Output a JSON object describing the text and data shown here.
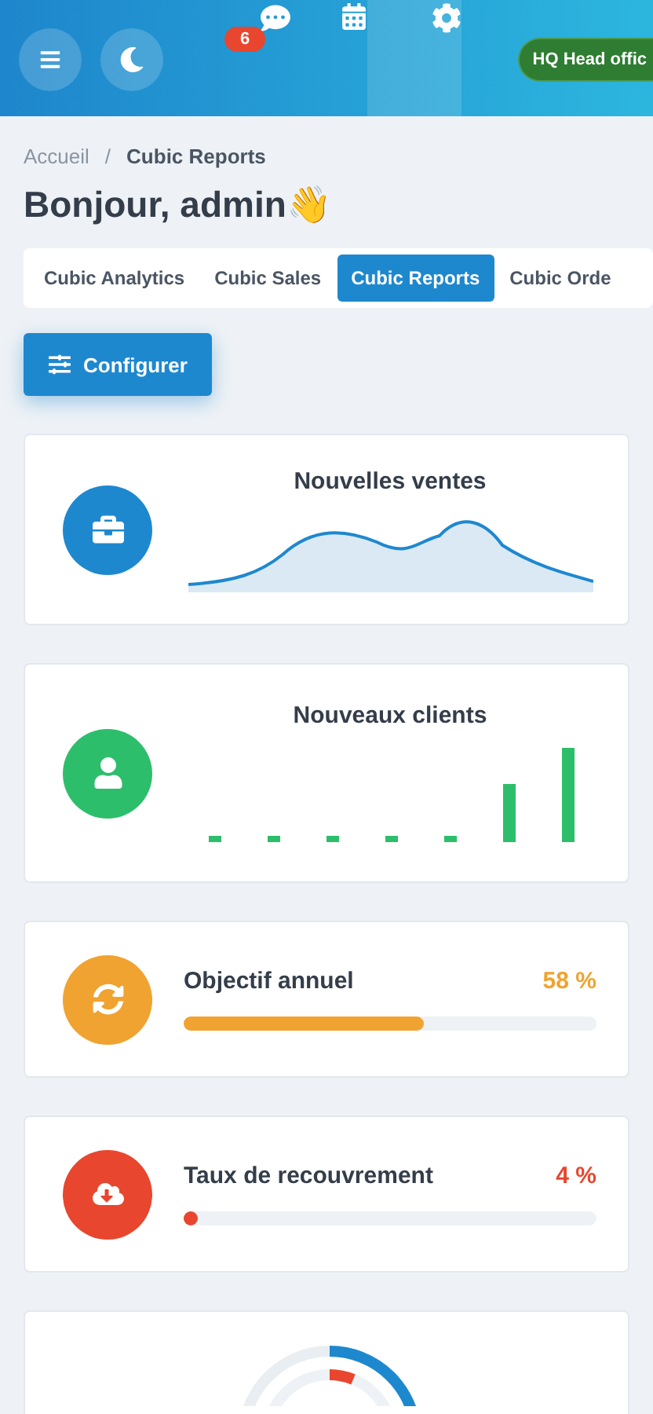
{
  "header": {
    "notifications_badge": "6",
    "branch": "HQ Head offic"
  },
  "breadcrumb": [
    "Accueil",
    "Cubic Reports"
  ],
  "breadcrumb_separator": "/",
  "greeting": "Bonjour, admin👋",
  "tabs": [
    {
      "label": "Cubic Analytics",
      "selected": false
    },
    {
      "label": "Cubic Sales",
      "selected": false
    },
    {
      "label": "Cubic Reports",
      "selected": true
    },
    {
      "label": "Cubic Orde",
      "selected": false
    }
  ],
  "configure_button": "Configurer",
  "cards": [
    {
      "kind": "area",
      "title": "Nouvelles ventes",
      "color": "#1e88cf"
    },
    {
      "kind": "bars",
      "title": "Nouveaux clients",
      "color": "#2dbe6c"
    },
    {
      "kind": "progress",
      "title": "Objectif annuel",
      "value": "58 %",
      "level": 0.58,
      "color": "#f0a330"
    },
    {
      "kind": "progress",
      "title": "Taux de recouvrement",
      "value": "4 %",
      "level": 0.03,
      "color": "#e8462e"
    },
    {
      "kind": "radial"
    }
  ]
}
